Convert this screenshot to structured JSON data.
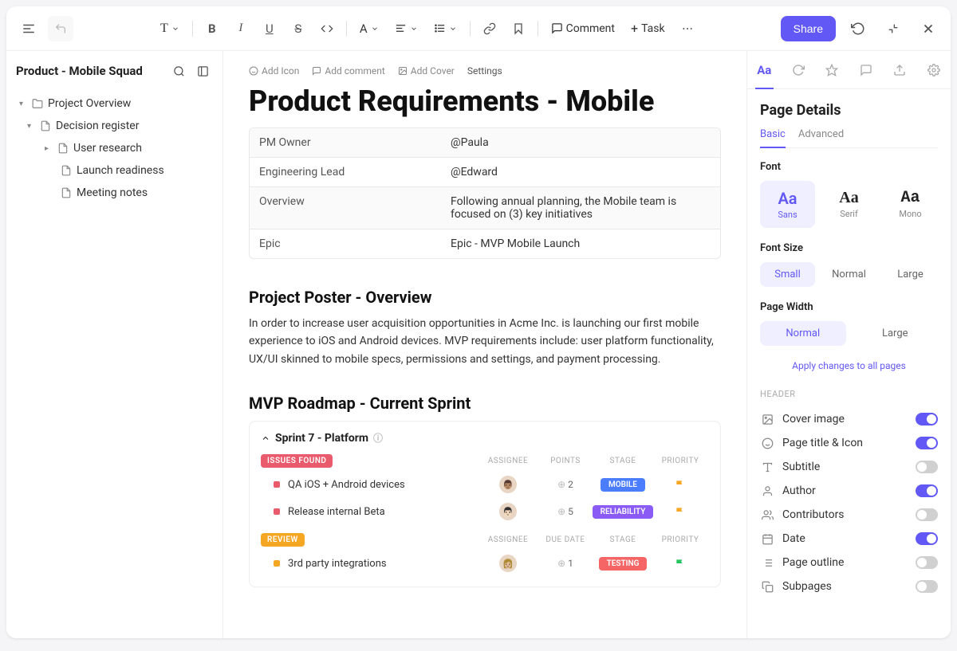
{
  "toolbar": {
    "comment_label": "Comment",
    "task_label": "Task",
    "share_label": "Share"
  },
  "sidebar": {
    "title": "Product - Mobile Squad",
    "tree": [
      {
        "label": "Project Overview"
      },
      {
        "label": "Decision register"
      },
      {
        "label": "User research"
      },
      {
        "label": "Launch readiness"
      },
      {
        "label": "Meeting notes"
      }
    ]
  },
  "page": {
    "meta": {
      "add_icon": "Add Icon",
      "add_comment": "Add comment",
      "add_cover": "Add Cover",
      "settings": "Settings"
    },
    "title": "Product Requirements - Mobile",
    "info": [
      {
        "key": "PM Owner",
        "val": "@Paula"
      },
      {
        "key": "Engineering Lead",
        "val": "@Edward"
      },
      {
        "key": "Overview",
        "val": "Following annual planning, the Mobile team is focused on (3) key initiatives"
      },
      {
        "key": "Epic",
        "val": "Epic - MVP Mobile Launch"
      }
    ],
    "h2a": "Project Poster - Overview",
    "para": "In order to increase user acquisition opportunities in Acme Inc. is launching our first mobile experience to iOS and Android devices. MVP requirements include: user platform functionality, UX/UI skinned to mobile specs, permissions and settings, and payment processing.",
    "h2b": "MVP Roadmap - Current Sprint",
    "sprint": {
      "title": "Sprint  7 - Platform",
      "groups": [
        {
          "badge": "ISSUES FOUND",
          "badge_color": "red",
          "cols": [
            "ASSIGNEE",
            "POINTS",
            "STAGE",
            "PRIORITY"
          ],
          "tasks": [
            {
              "sq": "red",
              "name": "QA iOS + Android devices",
              "points": "2",
              "stage": "MOBILE",
              "stage_color": "blue",
              "flag": "y"
            },
            {
              "sq": "red",
              "name": "Release internal Beta",
              "points": "5",
              "stage": "RELIABILITY",
              "stage_color": "purple",
              "flag": "y"
            }
          ]
        },
        {
          "badge": "REVIEW",
          "badge_color": "yellow",
          "cols": [
            "ASSIGNEE",
            "DUE DATE",
            "STAGE",
            "PRIORITY"
          ],
          "tasks": [
            {
              "sq": "yellow",
              "name": "3rd party integrations",
              "points": "1",
              "stage": "TESTING",
              "stage_color": "red",
              "flag": "g"
            }
          ]
        }
      ]
    }
  },
  "panel": {
    "title": "Page Details",
    "subtabs": {
      "basic": "Basic",
      "advanced": "Advanced"
    },
    "font_label": "Font",
    "fonts": [
      {
        "sample": "Aa",
        "name": "Sans"
      },
      {
        "sample": "Aa",
        "name": "Serif"
      },
      {
        "sample": "Aa",
        "name": "Mono"
      }
    ],
    "font_size_label": "Font Size",
    "sizes": [
      "Small",
      "Normal",
      "Large"
    ],
    "width_label": "Page Width",
    "widths": [
      "Normal",
      "Large"
    ],
    "apply_link": "Apply changes to all pages",
    "header_label": "HEADER",
    "toggles": [
      {
        "label": "Cover image",
        "on": true,
        "icon": "image"
      },
      {
        "label": "Page title & Icon",
        "on": true,
        "icon": "smile"
      },
      {
        "label": "Subtitle",
        "on": false,
        "icon": "text"
      },
      {
        "label": "Author",
        "on": true,
        "icon": "user"
      },
      {
        "label": "Contributors",
        "on": false,
        "icon": "users"
      },
      {
        "label": "Date",
        "on": true,
        "icon": "calendar"
      },
      {
        "label": "Page outline",
        "on": false,
        "icon": "list"
      },
      {
        "label": "Subpages",
        "on": false,
        "icon": "copy"
      }
    ]
  }
}
